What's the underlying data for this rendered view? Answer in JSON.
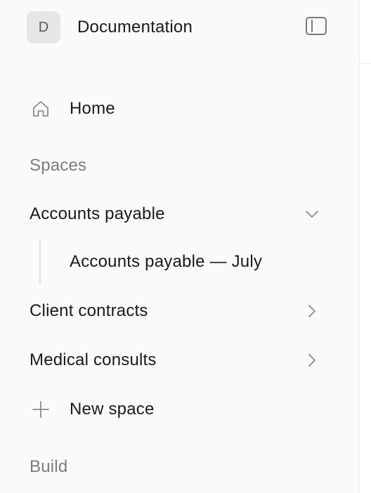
{
  "workspace": {
    "avatar_letter": "D",
    "title": "Documentation"
  },
  "nav": {
    "home_label": "Home"
  },
  "spaces": {
    "heading": "Spaces",
    "items": [
      {
        "label": "Accounts payable",
        "expanded": true,
        "children": [
          {
            "label": "Accounts payable — July"
          }
        ]
      },
      {
        "label": "Client contracts",
        "expanded": false
      },
      {
        "label": "Medical consults",
        "expanded": false
      }
    ],
    "new_space_label": "New space"
  },
  "build": {
    "heading": "Build"
  },
  "icons": {
    "sidebar_toggle": "sidebar-toggle-icon",
    "home": "home-icon",
    "expanded": "chevron-down-icon",
    "collapsed": "chevron-right-icon",
    "add": "plus-icon"
  },
  "colors": {
    "sidebar_bg": "#fafafa",
    "text_primary": "#1a1a1a",
    "text_muted": "#7b7b7b",
    "icon_gray": "#8a8a8a",
    "avatar_bg": "#e6e6e6"
  }
}
